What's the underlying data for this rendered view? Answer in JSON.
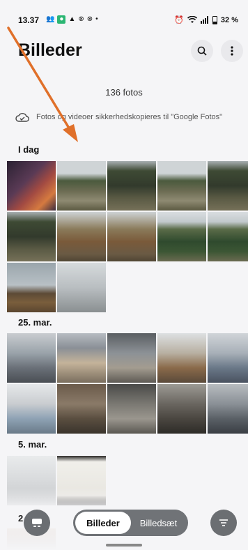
{
  "status": {
    "time": "13.37",
    "battery": "32 %"
  },
  "header": {
    "title": "Billeder"
  },
  "summary": {
    "count": "136 fotos",
    "backup_text": "Fotos og videoer sikkerhedskopieres til \"Google Fotos\""
  },
  "sections": [
    {
      "date": "I dag"
    },
    {
      "date": "25. mar."
    },
    {
      "date": "5. mar."
    },
    {
      "date": "2"
    }
  ],
  "bottom_nav": {
    "tab_pictures": "Billeder",
    "tab_albums": "Billedsæt"
  },
  "icons": {
    "search": "search-icon",
    "menu": "more-vertical-icon",
    "cloud": "cloud-check-icon",
    "filter": "filter-icon",
    "albums_fab": "albums-icon"
  },
  "colors": {
    "accent_arrow": "#e0702a",
    "segment_bg": "#707377"
  }
}
